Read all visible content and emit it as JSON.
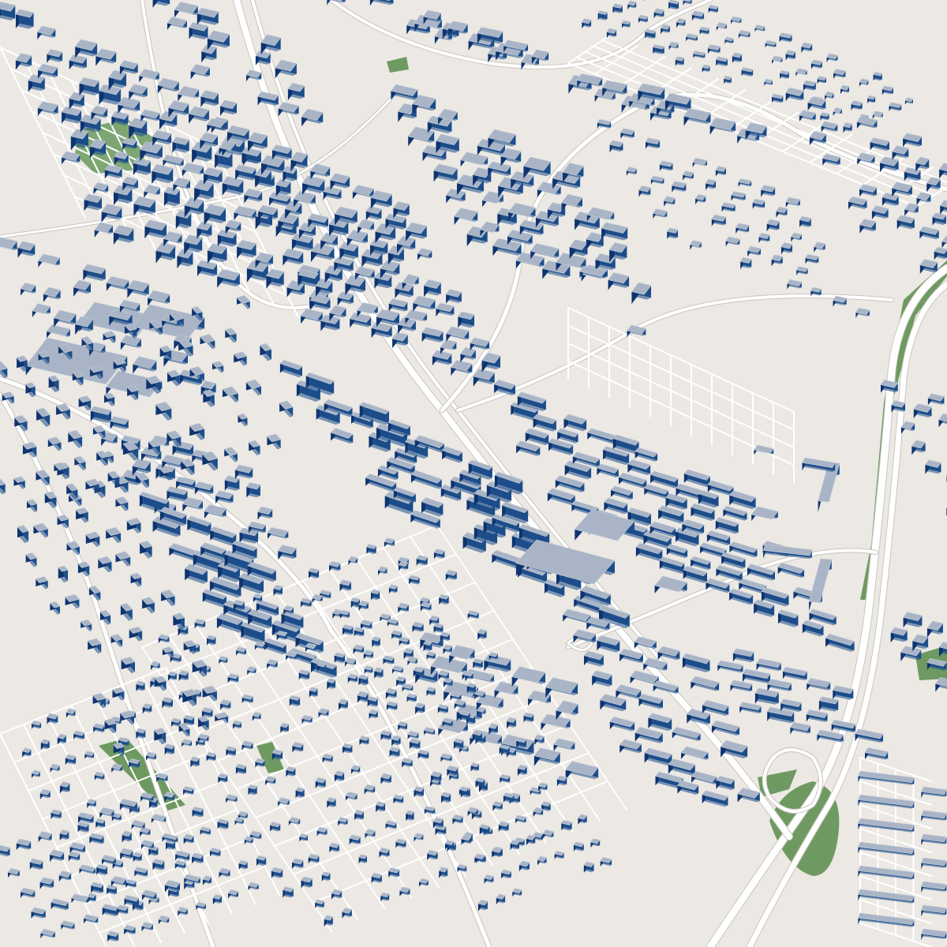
{
  "map": {
    "style": "3D isometric white-clay city model",
    "colors": {
      "ground": "#ece8e3",
      "roof": "#a9b5c6",
      "wall_shadow": "#1c4d8a",
      "wall_dark": "#0e3470",
      "road": "#ffffff",
      "road_edge": "#c9c5bf",
      "green": "#6e9a62",
      "green_dark": "#5c8851"
    },
    "districts": [
      {
        "id": "dense-old-town",
        "kind": "dense-blocks"
      },
      {
        "id": "industrial-west",
        "kind": "large-halls"
      },
      {
        "id": "residential-blocks-center",
        "kind": "u-shaped-blocks"
      },
      {
        "id": "commercial-center",
        "kind": "large-complex"
      },
      {
        "id": "suburban-houses-south",
        "kind": "single-houses"
      },
      {
        "id": "row-houses-north-east",
        "kind": "row-houses"
      },
      {
        "id": "open-field-east",
        "kind": "empty-plots"
      },
      {
        "id": "apartment-rows-east",
        "kind": "slab-blocks"
      },
      {
        "id": "garages-south-east",
        "kind": "long-sheds"
      }
    ],
    "green_areas": [
      {
        "id": "park-north-west"
      },
      {
        "id": "motorway-verge"
      },
      {
        "id": "interchange-loop"
      },
      {
        "id": "park-south-west"
      },
      {
        "id": "plaza-green-east"
      }
    ]
  }
}
